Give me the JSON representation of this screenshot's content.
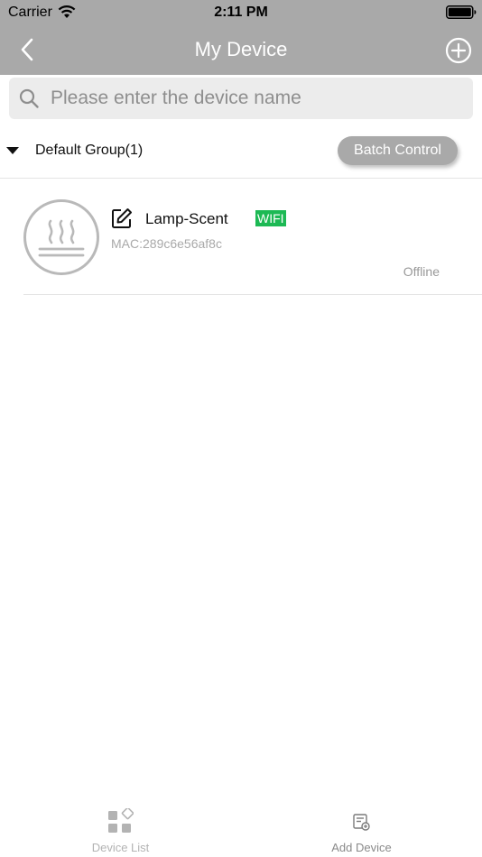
{
  "status_bar": {
    "carrier": "Carrier",
    "time": "2:11 PM",
    "icons": [
      "wifi-icon",
      "battery-icon"
    ]
  },
  "nav": {
    "title": "My Device",
    "back_icon": "chevron-left-icon",
    "add_icon": "plus-circle-icon"
  },
  "search": {
    "placeholder": "Please enter the device name",
    "value": "",
    "icon": "search-icon"
  },
  "group": {
    "title": "Default Group(1)",
    "expanded": true,
    "batch_label": "Batch Control"
  },
  "devices": [
    {
      "name": "Lamp-Scent",
      "badge": "WIFI",
      "mac": "MAC:289c6e56af8c",
      "status": "Offline",
      "icon": "heater-icon"
    }
  ],
  "tabs": [
    {
      "label": "Device List",
      "icon": "device-list-icon",
      "active": false
    },
    {
      "label": "Add Device",
      "icon": "add-device-icon",
      "active": true
    }
  ],
  "colors": {
    "header_bg": "#a9a9a9",
    "badge_bg": "#1db954",
    "search_bg": "#ececec"
  }
}
